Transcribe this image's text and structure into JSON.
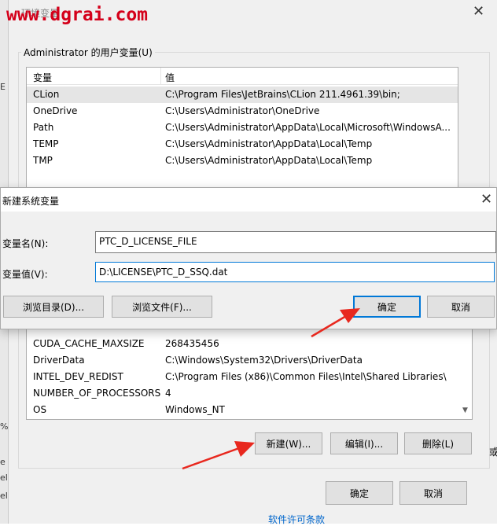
{
  "watermark": "www.dgrai.com",
  "env_dialog": {
    "title": "环境变量",
    "user_vars_label": "Administrator 的用户变量(U)",
    "columns": [
      "变量",
      "值"
    ],
    "user_vars": [
      {
        "name": "CLion",
        "value": "C:\\Program Files\\JetBrains\\CLion 211.4961.39\\bin;"
      },
      {
        "name": "OneDrive",
        "value": "C:\\Users\\Administrator\\OneDrive"
      },
      {
        "name": "Path",
        "value": "C:\\Users\\Administrator\\AppData\\Local\\Microsoft\\WindowsA..."
      },
      {
        "name": "TEMP",
        "value": "C:\\Users\\Administrator\\AppData\\Local\\Temp"
      },
      {
        "name": "TMP",
        "value": "C:\\Users\\Administrator\\AppData\\Local\\Temp"
      }
    ],
    "system_vars": [
      {
        "name": "CUDA_CACHE_MAXSIZE",
        "value": "268435456"
      },
      {
        "name": "DriverData",
        "value": "C:\\Windows\\System32\\Drivers\\DriverData"
      },
      {
        "name": "INTEL_DEV_REDIST",
        "value": "C:\\Program Files (x86)\\Common Files\\Intel\\Shared Libraries\\"
      },
      {
        "name": "NUMBER_OF_PROCESSORS",
        "value": "4"
      },
      {
        "name": "OS",
        "value": "Windows_NT"
      }
    ],
    "buttons": {
      "new": "新建(W)...",
      "edit": "编辑(I)...",
      "delete": "删除(L)"
    },
    "ok": "确定",
    "cancel": "取消",
    "bottom_link": "软件许可条款"
  },
  "new_dialog": {
    "title": "新建系统变量",
    "name_label": "变量名(N):",
    "name_value": "PTC_D_LICENSE_FILE",
    "value_label": "变量值(V):",
    "value_value": "D:\\LICENSE\\PTC_D_SSQ.dat",
    "browse_dir": "浏览目录(D)...",
    "browse_file": "浏览文件(F)...",
    "ok": "确定",
    "cancel": "取消"
  },
  "bg_fragments": [
    "E",
    "%",
    "e",
    "el",
    "el",
    "或"
  ],
  "colors": {
    "accent": "#0078d7",
    "arrow": "#e8281e",
    "watermark": "#d4001a"
  }
}
